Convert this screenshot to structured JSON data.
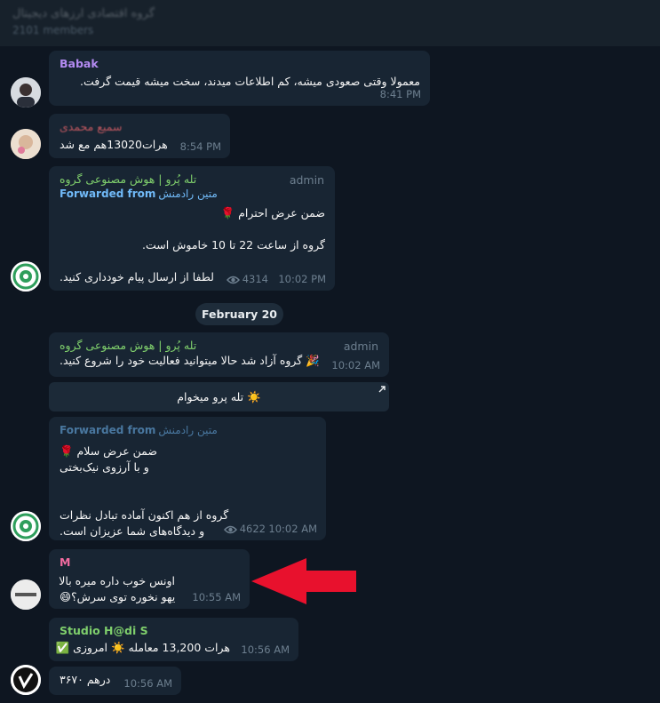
{
  "header": {
    "title": "گروه اقتصادی ارزهای دیجیتال",
    "members": "2101 members"
  },
  "messages": [
    {
      "sender": "Babak",
      "lines": [
        "معمولا وقتی صعودی میشه، کم اطلاعات میدند، سخت میشه قیمت گرفت."
      ],
      "time": "8:41 PM"
    },
    {
      "sender": "سمیع محمدی",
      "lines": [
        "هرات13020هم مع شد"
      ],
      "time": "8:54 PM"
    },
    {
      "sender": "تله پُرو | هوش مصنوعی گروه",
      "badge": "admin",
      "forwarded_label": "Forwarded from",
      "forwarded_name": "متین رادمنش",
      "lines": [
        "ضمن عرض احترام 🌹",
        "",
        "گروه از ساعت 22 تا 10 خاموش است.",
        "",
        "لطفا از ارسال پیام خودداری کنید."
      ],
      "views": "4314",
      "time": "10:02 PM"
    },
    {
      "sender": "تله پُرو | هوش مصنوعی گروه",
      "badge": "admin",
      "lines": [
        "🎉 گروه آزاد شد حالا میتوانید فعالیت خود را شروع کنید."
      ],
      "time": "10:02 AM"
    },
    {
      "button_label": "☀️ تله پرو میخوام"
    },
    {
      "forwarded_label": "Forwarded from",
      "forwarded_name": "متین رادمنش",
      "lines": [
        "ضمن عرض سلام 🌹",
        "و با آرزوی نیک‌بختی",
        "",
        "",
        "گروه از هم اکنون آماده تبادل نظرات",
        "و دیدگاه‌های شما عزیزان است."
      ],
      "views": "4622",
      "time": "10:02 AM"
    },
    {
      "sender": "M",
      "lines": [
        "اونس خوب داره میره بالا",
        "یهو نخوره توی سرش؟😄"
      ],
      "time": "10:55 AM"
    },
    {
      "sender": "Studio H@di S",
      "lines": [
        "هرات 13,200 معامله ☀️ امروزی ✅"
      ],
      "time": "10:56 AM"
    },
    {
      "lines": [
        "درهم ۳۶۷۰"
      ],
      "time": "10:56 AM"
    }
  ],
  "date_separator": "February 20",
  "colors": {
    "background": "#0e1621",
    "bubble": "#182533",
    "sender_babak": "#b48bf2",
    "sender_samie": "#e5636a",
    "sender_group": "#7fcf6c",
    "sender_m": "#f36ba0",
    "sender_studio": "#7fcf6c",
    "link": "#71baf8",
    "muted": "#6d7f8f",
    "arrow": "#e8112d"
  },
  "icons": [
    "eye-icon",
    "arrow-up-right-icon",
    "red-arrow-annotation"
  ]
}
